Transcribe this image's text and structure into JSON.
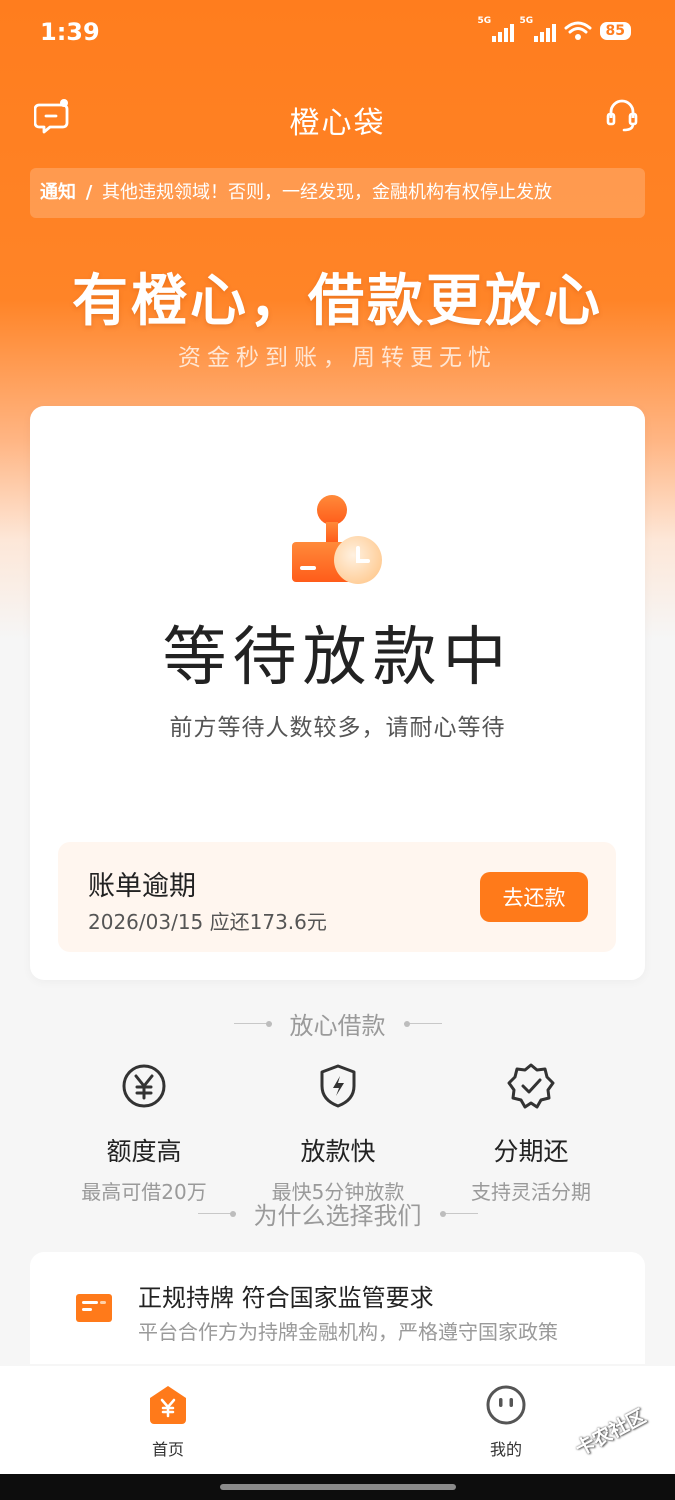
{
  "statusbar": {
    "time": "1:39",
    "sim1": "5G",
    "sim2": "5G",
    "battery": "85"
  },
  "navbar": {
    "title": "橙心袋",
    "left_icon": "message-icon",
    "right_icon": "headset-icon"
  },
  "notice": {
    "label": "通知",
    "separator": "/",
    "text": "其他违规领域！否则，一经发现，金融机构有权停止发放"
  },
  "hero": {
    "slogan": "有橙心，借款更放心",
    "subslogan": "资金秒到账，周转更无忧"
  },
  "status_card": {
    "title": "等待放款中",
    "desc": "前方等待人数较多，请耐心等待",
    "bill": {
      "title": "账单逾期",
      "info": "2026/03/15 应还173.6元",
      "button": "去还款"
    }
  },
  "features_section": {
    "title": "放心借款",
    "items": [
      {
        "icon": "yuan-circle-icon",
        "title": "额度高",
        "desc": "最高可借20万"
      },
      {
        "icon": "lightning-shield-icon",
        "title": "放款快",
        "desc": "最快5分钟放款"
      },
      {
        "icon": "check-badge-icon",
        "title": "分期还",
        "desc": "支持灵活分期"
      }
    ]
  },
  "why_section": {
    "title": "为什么选择我们",
    "card": {
      "title": "正规持牌 符合国家监管要求",
      "desc": "平台合作方为持牌金融机构，严格遵守国家政策"
    }
  },
  "tabbar": {
    "tabs": [
      {
        "label": "首页",
        "icon": "home-yuan-icon"
      },
      {
        "label": "我的",
        "icon": "face-icon"
      }
    ]
  },
  "watermark": "卡农社区",
  "colors": {
    "brand": "#ff7d1e",
    "button": "#ff7a1a"
  }
}
